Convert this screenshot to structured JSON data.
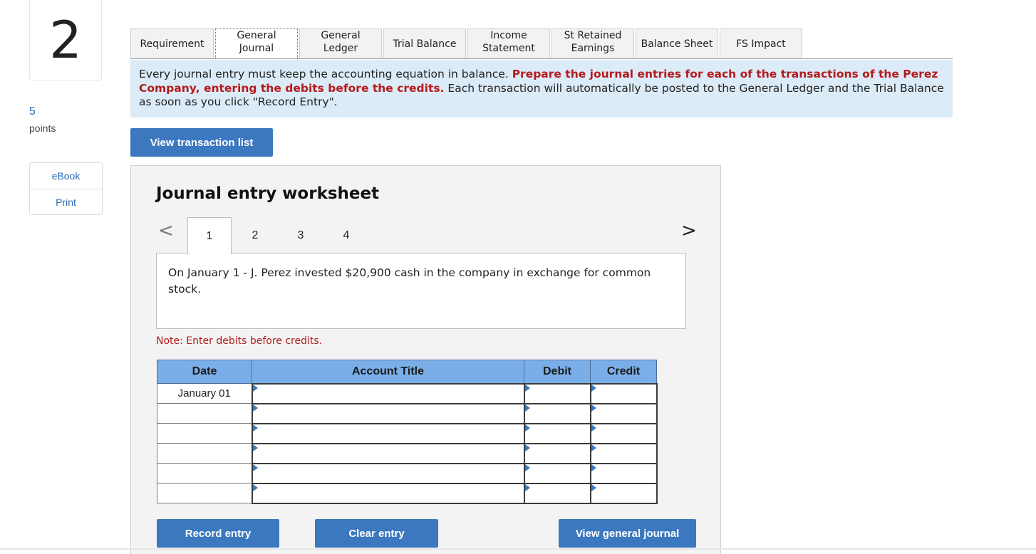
{
  "question": {
    "number": "2",
    "points_value": "5",
    "points_label": "points"
  },
  "side_links": [
    {
      "label": "eBook"
    },
    {
      "label": "Print"
    }
  ],
  "tabs": [
    {
      "label": "Requirement"
    },
    {
      "label": "General Journal"
    },
    {
      "label": "General Ledger"
    },
    {
      "label": "Trial Balance"
    },
    {
      "label": "Income Statement"
    },
    {
      "label": "St Retained Earnings"
    },
    {
      "label": "Balance Sheet"
    },
    {
      "label": "FS Impact"
    }
  ],
  "instructions": {
    "lead": "Every journal entry must keep the accounting equation in balance. ",
    "highlight": "Prepare the journal entries for each of the transactions of the Perez Company, entering the debits before the credits.",
    "tail": " Each transaction will automatically be posted to the General Ledger and the Trial Balance as soon as you click \"Record Entry\"."
  },
  "buttons": {
    "view_transaction_list": "View transaction list",
    "record_entry": "Record entry",
    "clear_entry": "Clear entry",
    "view_general_journal": "View general journal"
  },
  "worksheet": {
    "title": "Journal entry worksheet",
    "prev_arrow": "<",
    "next_arrow": ">",
    "pages": [
      "1",
      "2",
      "3",
      "4"
    ],
    "active_page": "1",
    "transaction_text": "On January 1 - J. Perez invested $20,900 cash in the company in exchange for common stock.",
    "note": "Note: Enter debits before credits."
  },
  "journal_table": {
    "headers": {
      "date": "Date",
      "account": "Account Title",
      "debit": "Debit",
      "credit": "Credit"
    },
    "rows": [
      {
        "date": "January 01",
        "account": "",
        "debit": "",
        "credit": ""
      },
      {
        "date": "",
        "account": "",
        "debit": "",
        "credit": ""
      },
      {
        "date": "",
        "account": "",
        "debit": "",
        "credit": ""
      },
      {
        "date": "",
        "account": "",
        "debit": "",
        "credit": ""
      },
      {
        "date": "",
        "account": "",
        "debit": "",
        "credit": ""
      },
      {
        "date": "",
        "account": "",
        "debit": "",
        "credit": ""
      }
    ]
  },
  "colors": {
    "accent_blue": "#3b78c0",
    "banner_bg": "#dcebf8",
    "highlight_red": "#b31b1b",
    "table_header": "#7aaee8"
  }
}
